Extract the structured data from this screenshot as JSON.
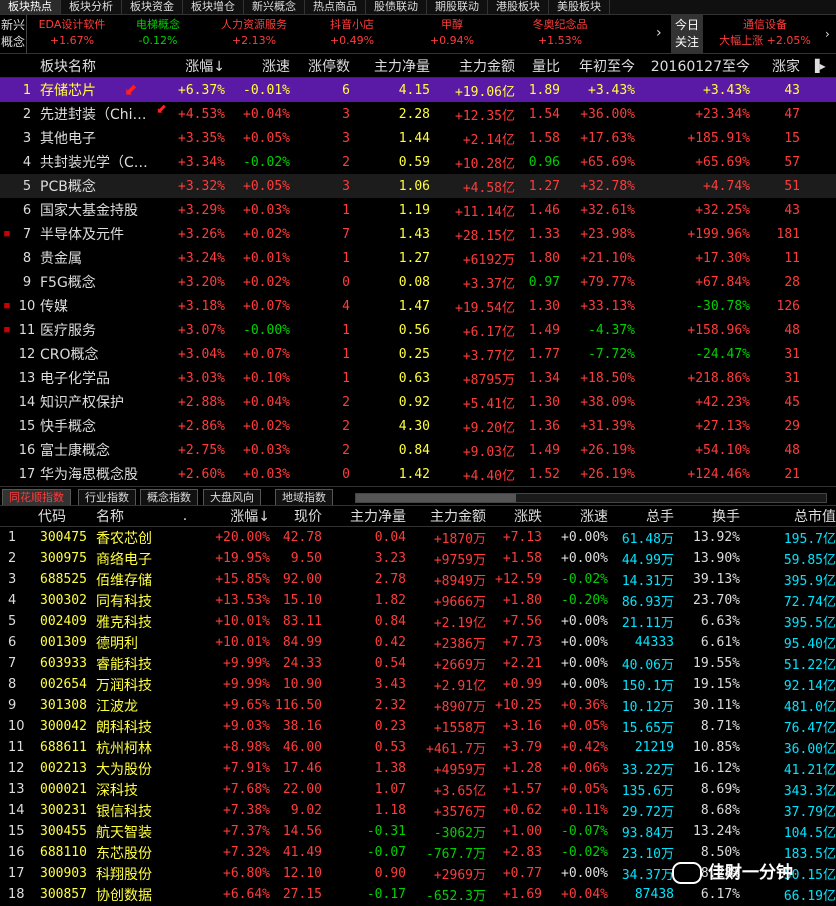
{
  "top_tabs": [
    "板块热点",
    "板块分析",
    "板块资金",
    "板块增仓",
    "新兴概念",
    "热点商品",
    "股债联动",
    "期股联动",
    "港股板块",
    "美股板块"
  ],
  "ticker": {
    "left_label": [
      "新兴",
      "概念"
    ],
    "items": [
      {
        "name": "EDA设计软件",
        "value": "+1.67%",
        "up": true
      },
      {
        "name": "电梯概念",
        "value": "-0.12%",
        "up": false
      },
      {
        "name": "人力资源服务",
        "value": "+2.13%",
        "up": true
      },
      {
        "name": "抖音小店",
        "value": "+0.49%",
        "up": true
      },
      {
        "name": "甲醇",
        "value": "+0.94%",
        "up": true
      },
      {
        "name": "冬奥纪念品",
        "value": "+1.53%",
        "up": true
      }
    ],
    "arrow": "›",
    "today_label": [
      "今日",
      "关注"
    ],
    "right": {
      "name": "通信设备",
      "status": "大幅上涨",
      "value": "+2.05%"
    },
    "more": "›"
  },
  "upper_table": {
    "headers": [
      "板块名称",
      "涨幅",
      "涨速",
      "涨停数",
      "主力净量",
      "主力金额",
      "量比",
      "年初至今",
      "20160127至今",
      "涨家"
    ],
    "sort_indicator": "↓",
    "rows": [
      {
        "idx": "1",
        "mark": "",
        "name": "存储芯片",
        "chg": "+6.37%",
        "speed": "-0.01%",
        "limit": "6",
        "net": "4.15",
        "amt": "+19.06亿",
        "vr": "1.89",
        "ytd": "+3.43%",
        "since": "+3.43%",
        "up": "43"
      },
      {
        "idx": "2",
        "mark": "",
        "name": "先进封装（Chi…",
        "chg": "+4.53%",
        "speed": "+0.04%",
        "limit": "3",
        "net": "2.28",
        "amt": "+12.35亿",
        "vr": "1.54",
        "ytd": "+36.00%",
        "since": "+23.34%",
        "up": "47"
      },
      {
        "idx": "3",
        "mark": "",
        "name": "其他电子",
        "chg": "+3.35%",
        "speed": "+0.05%",
        "limit": "3",
        "net": "1.44",
        "amt": "+2.14亿",
        "vr": "1.58",
        "ytd": "+17.63%",
        "since": "+185.91%",
        "up": "15"
      },
      {
        "idx": "4",
        "mark": "",
        "name": "共封装光学（C…",
        "chg": "+3.34%",
        "speed": "-0.02%",
        "limit": "2",
        "net": "0.59",
        "amt": "+10.28亿",
        "vr": "0.96",
        "ytd": "+65.69%",
        "since": "+65.69%",
        "up": "57"
      },
      {
        "idx": "5",
        "mark": "",
        "name": "PCB概念",
        "chg": "+3.32%",
        "speed": "+0.05%",
        "limit": "3",
        "net": "1.06",
        "amt": "+4.58亿",
        "vr": "1.27",
        "ytd": "+32.78%",
        "since": "+4.74%",
        "up": "51"
      },
      {
        "idx": "6",
        "mark": "",
        "name": "国家大基金持股",
        "chg": "+3.29%",
        "speed": "+0.03%",
        "limit": "1",
        "net": "1.19",
        "amt": "+11.14亿",
        "vr": "1.46",
        "ytd": "+32.61%",
        "since": "+32.25%",
        "up": "43"
      },
      {
        "idx": "7",
        "mark": "■",
        "name": "半导体及元件",
        "chg": "+3.26%",
        "speed": "+0.02%",
        "limit": "7",
        "net": "1.43",
        "amt": "+28.15亿",
        "vr": "1.33",
        "ytd": "+23.98%",
        "since": "+199.96%",
        "up": "181"
      },
      {
        "idx": "8",
        "mark": "",
        "name": "贵金属",
        "chg": "+3.24%",
        "speed": "+0.01%",
        "limit": "1",
        "net": "1.27",
        "amt": "+6192万",
        "vr": "1.80",
        "ytd": "+21.10%",
        "since": "+17.30%",
        "up": "11"
      },
      {
        "idx": "9",
        "mark": "",
        "name": "F5G概念",
        "chg": "+3.20%",
        "speed": "+0.02%",
        "limit": "0",
        "net": "0.08",
        "amt": "+3.37亿",
        "vr": "0.97",
        "ytd": "+79.77%",
        "since": "+67.84%",
        "up": "28"
      },
      {
        "idx": "10",
        "mark": "■",
        "name": "传媒",
        "chg": "+3.18%",
        "speed": "+0.07%",
        "limit": "4",
        "net": "1.47",
        "amt": "+19.54亿",
        "vr": "1.30",
        "ytd": "+33.13%",
        "since": "-30.78%",
        "up": "126"
      },
      {
        "idx": "11",
        "mark": "■",
        "name": "医疗服务",
        "chg": "+3.07%",
        "speed": "-0.00%",
        "limit": "1",
        "net": "0.56",
        "amt": "+6.17亿",
        "vr": "1.49",
        "ytd": "-4.37%",
        "since": "+158.96%",
        "up": "48"
      },
      {
        "idx": "12",
        "mark": "",
        "name": "CRO概念",
        "chg": "+3.04%",
        "speed": "+0.07%",
        "limit": "1",
        "net": "0.25",
        "amt": "+3.77亿",
        "vr": "1.77",
        "ytd": "-7.72%",
        "since": "-24.47%",
        "up": "31"
      },
      {
        "idx": "13",
        "mark": "",
        "name": "电子化学品",
        "chg": "+3.03%",
        "speed": "+0.10%",
        "limit": "1",
        "net": "0.63",
        "amt": "+8795万",
        "vr": "1.34",
        "ytd": "+18.50%",
        "since": "+218.86%",
        "up": "31"
      },
      {
        "idx": "14",
        "mark": "",
        "name": "知识产权保护",
        "chg": "+2.88%",
        "speed": "+0.04%",
        "limit": "2",
        "net": "0.92",
        "amt": "+5.41亿",
        "vr": "1.30",
        "ytd": "+38.09%",
        "since": "+42.23%",
        "up": "45"
      },
      {
        "idx": "15",
        "mark": "",
        "name": "快手概念",
        "chg": "+2.86%",
        "speed": "+0.02%",
        "limit": "2",
        "net": "4.30",
        "amt": "+9.20亿",
        "vr": "1.36",
        "ytd": "+31.39%",
        "since": "+27.13%",
        "up": "29"
      },
      {
        "idx": "16",
        "mark": "",
        "name": "富士康概念",
        "chg": "+2.75%",
        "speed": "+0.03%",
        "limit": "2",
        "net": "0.84",
        "amt": "+9.03亿",
        "vr": "1.49",
        "ytd": "+26.19%",
        "since": "+54.10%",
        "up": "48"
      },
      {
        "idx": "17",
        "mark": "",
        "name": "华为海思概念股",
        "chg": "+2.60%",
        "speed": "+0.03%",
        "limit": "0",
        "net": "1.42",
        "amt": "+4.40亿",
        "vr": "1.52",
        "ytd": "+26.19%",
        "since": "+124.46%",
        "up": "21"
      }
    ]
  },
  "bottom_tabs": [
    "同花顺指数",
    "行业指数",
    "概念指数",
    "大盘风向",
    "地域指数"
  ],
  "lower_table": {
    "headers": [
      "代码",
      "名称",
      "涨幅",
      "现价",
      "主力净量",
      "主力金额",
      "涨跌",
      "涨速",
      "总手",
      "换手",
      "总市值"
    ],
    "sort_indicator": "↓",
    "dot": ".",
    "rows": [
      {
        "idx": "1",
        "code": "300475",
        "name": "香农芯创",
        "chg": "+20.00%",
        "price": "42.78",
        "net": "0.04",
        "amt": "+1870万",
        "diff": "+7.13",
        "speed": "+0.00%",
        "vol": "61.48万",
        "turn": "13.92%",
        "cap": "195.7亿"
      },
      {
        "idx": "2",
        "code": "300975",
        "name": "商络电子",
        "chg": "+19.95%",
        "price": "9.50",
        "net": "3.23",
        "amt": "+9759万",
        "diff": "+1.58",
        "speed": "+0.00%",
        "vol": "44.99万",
        "turn": "13.90%",
        "cap": "59.85亿"
      },
      {
        "idx": "3",
        "code": "688525",
        "name": "佰维存储",
        "chg": "+15.85%",
        "price": "92.00",
        "net": "2.78",
        "amt": "+8949万",
        "diff": "+12.59",
        "speed": "-0.02%",
        "vol": "14.31万",
        "turn": "39.13%",
        "cap": "395.9亿"
      },
      {
        "idx": "4",
        "code": "300302",
        "name": "同有科技",
        "chg": "+13.53%",
        "price": "15.10",
        "net": "1.82",
        "amt": "+9666万",
        "diff": "+1.80",
        "speed": "-0.20%",
        "vol": "86.93万",
        "turn": "23.70%",
        "cap": "72.74亿"
      },
      {
        "idx": "5",
        "code": "002409",
        "name": "雅克科技",
        "chg": "+10.01%",
        "price": "83.11",
        "net": "0.84",
        "amt": "+2.19亿",
        "diff": "+7.56",
        "speed": "+0.00%",
        "vol": "21.11万",
        "turn": "6.63%",
        "cap": "395.5亿"
      },
      {
        "idx": "6",
        "code": "001309",
        "name": "德明利",
        "chg": "+10.01%",
        "price": "84.99",
        "net": "0.42",
        "amt": "+2386万",
        "diff": "+7.73",
        "speed": "+0.00%",
        "vol": "44333",
        "turn": "6.61%",
        "cap": "95.40亿"
      },
      {
        "idx": "7",
        "code": "603933",
        "name": "睿能科技",
        "chg": "+9.99%",
        "price": "24.33",
        "net": "0.54",
        "amt": "+2669万",
        "diff": "+2.21",
        "speed": "+0.00%",
        "vol": "40.06万",
        "turn": "19.55%",
        "cap": "51.22亿"
      },
      {
        "idx": "8",
        "code": "002654",
        "name": "万润科技",
        "chg": "+9.99%",
        "price": "10.90",
        "net": "3.43",
        "amt": "+2.91亿",
        "diff": "+0.99",
        "speed": "+0.00%",
        "vol": "150.1万",
        "turn": "19.15%",
        "cap": "92.14亿"
      },
      {
        "idx": "9",
        "code": "301308",
        "name": "江波龙",
        "chg": "+9.65%",
        "price": "116.50",
        "net": "2.32",
        "amt": "+8907万",
        "diff": "+10.25",
        "speed": "+0.36%",
        "vol": "10.12万",
        "turn": "30.11%",
        "cap": "481.0亿"
      },
      {
        "idx": "10",
        "code": "300042",
        "name": "朗科科技",
        "chg": "+9.03%",
        "price": "38.16",
        "net": "0.23",
        "amt": "+1558万",
        "diff": "+3.16",
        "speed": "+0.05%",
        "vol": "15.65万",
        "turn": "8.71%",
        "cap": "76.47亿"
      },
      {
        "idx": "11",
        "code": "688611",
        "name": "杭州柯林",
        "chg": "+8.98%",
        "price": "46.00",
        "net": "0.53",
        "amt": "+461.7万",
        "diff": "+3.79",
        "speed": "+0.42%",
        "vol": "21219",
        "turn": "10.85%",
        "cap": "36.00亿"
      },
      {
        "idx": "12",
        "code": "002213",
        "name": "大为股份",
        "chg": "+7.91%",
        "price": "17.46",
        "net": "1.38",
        "amt": "+4959万",
        "diff": "+1.28",
        "speed": "+0.06%",
        "vol": "33.22万",
        "turn": "16.12%",
        "cap": "41.21亿"
      },
      {
        "idx": "13",
        "code": "000021",
        "name": "深科技",
        "chg": "+7.68%",
        "price": "22.00",
        "net": "1.07",
        "amt": "+3.65亿",
        "diff": "+1.57",
        "speed": "+0.05%",
        "vol": "135.6万",
        "turn": "8.69%",
        "cap": "343.3亿"
      },
      {
        "idx": "14",
        "code": "300231",
        "name": "银信科技",
        "chg": "+7.38%",
        "price": "9.02",
        "net": "1.18",
        "amt": "+3576万",
        "diff": "+0.62",
        "speed": "+0.11%",
        "vol": "29.72万",
        "turn": "8.68%",
        "cap": "37.79亿"
      },
      {
        "idx": "15",
        "code": "300455",
        "name": "航天智装",
        "chg": "+7.37%",
        "price": "14.56",
        "net": "-0.31",
        "amt": "-3062万",
        "diff": "+1.00",
        "speed": "-0.07%",
        "vol": "93.84万",
        "turn": "13.24%",
        "cap": "104.5亿"
      },
      {
        "idx": "16",
        "code": "688110",
        "name": "东芯股份",
        "chg": "+7.32%",
        "price": "41.49",
        "net": "-0.07",
        "amt": "-767.7万",
        "diff": "+2.83",
        "speed": "-0.02%",
        "vol": "23.10万",
        "turn": "8.50%",
        "cap": "183.5亿"
      },
      {
        "idx": "17",
        "code": "300903",
        "name": "科翔股份",
        "chg": "+6.80%",
        "price": "12.10",
        "net": "0.90",
        "amt": "+2969万",
        "diff": "+0.77",
        "speed": "+0.00%",
        "vol": "34.37万",
        "turn": "8.28%",
        "cap": "50.15亿"
      },
      {
        "idx": "18",
        "code": "300857",
        "name": "协创数据",
        "chg": "+6.64%",
        "price": "27.15",
        "net": "-0.17",
        "amt": "-652.3万",
        "diff": "+1.69",
        "speed": "+0.04%",
        "vol": "87438",
        "turn": "6.17%",
        "cap": "66.19亿"
      }
    ]
  },
  "watermark": "佳财一分钟"
}
